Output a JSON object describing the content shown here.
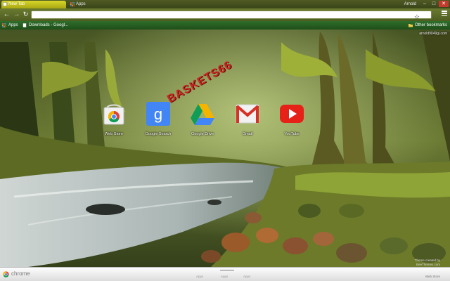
{
  "tabs": [
    {
      "label": "New Tab",
      "active": true
    },
    {
      "label": "Apps",
      "active": false
    }
  ],
  "window": {
    "user": "Arnold"
  },
  "omnibox": {
    "value": ""
  },
  "bookmarks": {
    "apps_label": "Apps",
    "downloads_label": "Downloads - Googl...",
    "other_label": "Other bookmarks"
  },
  "account_email": "arnold9049gi.com",
  "apps": [
    {
      "label": "Web Store",
      "icon": "web-store-icon"
    },
    {
      "label": "Google Search",
      "icon": "google-search-icon"
    },
    {
      "label": "Google Drive",
      "icon": "google-drive-icon"
    },
    {
      "label": "Gmail",
      "icon": "gmail-icon"
    },
    {
      "label": "YouTube",
      "icon": "youtube-icon"
    }
  ],
  "watermark": "BASKETS66",
  "theme_credit": {
    "line1": "Theme created by",
    "line2": "BeeThemes.com"
  },
  "bottom_bar": {
    "brand": "chrome",
    "tabs": [
      "Apps",
      "Apps",
      "Apps"
    ],
    "webstore": "Web Store"
  },
  "colors": {
    "tab_active": "#c9c71f",
    "toolbar": "#5f6f28",
    "bookmarks_bar": "#2a6225",
    "close_button": "#c03b2b"
  }
}
